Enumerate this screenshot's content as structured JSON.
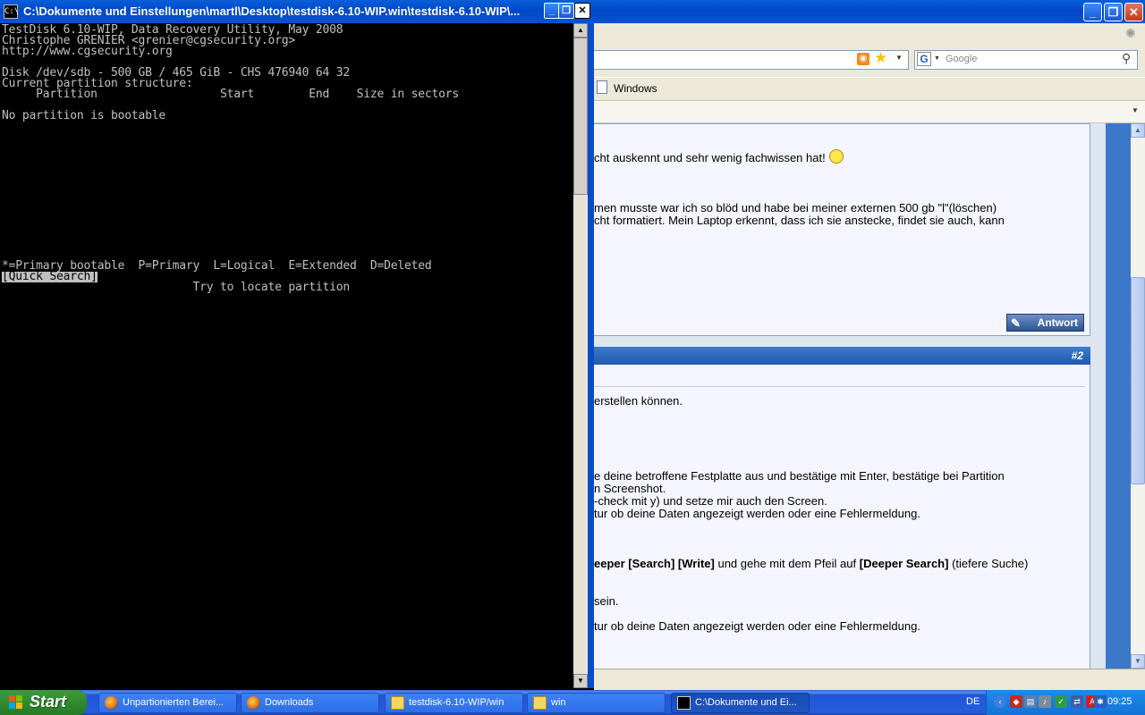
{
  "browser": {
    "search_placeholder": "Google",
    "bookmark_label": "Windows",
    "post1": {
      "line1": "cht auskennt und sehr wenig fachwissen hat!",
      "line2": "men musste war ich so blöd und habe bei meiner externen 500 gb \"l\"(löschen)",
      "line3": "cht formatiert. Mein Laptop erkennt, dass ich sie anstecke, findet sie auch, kann",
      "reply_label": "Antwort"
    },
    "post2": {
      "number": "#2",
      "line1": "erstellen können.",
      "line2": "e deine betroffene Festplatte aus und bestätige mit Enter, bestätige bei Partition",
      "line3": "n Screenshot.",
      "line4": "-check mit y) und setze mir auch den Screen.",
      "line5": "tur ob deine Daten angezeigt werden oder eine Fehlermeldung.",
      "line6_b1": "eeper [Search] [Write]",
      "line6_t1": " und gehe mit dem Pfeil auf ",
      "line6_b2": "[Deeper Search]",
      "line6_t2": " (tiefere Suche)",
      "line7": "sein.",
      "line8": "tur ob deine Daten angezeigt werden oder eine Fehlermeldung."
    }
  },
  "console": {
    "title": "C:\\Dokumente und Einstellungen\\martl\\Desktop\\testdisk-6.10-WIP.win\\testdisk-6.10-WIP\\...",
    "lines": [
      "TestDisk 6.10-WIP, Data Recovery Utility, May 2008",
      "Christophe GRENIER <grenier@cgsecurity.org>",
      "http://www.cgsecurity.org",
      "Disk /dev/sdb - 500 GB / 465 GiB - CHS 476940 64 32",
      "Current partition structure:",
      "     Partition                  Start        End    Size in sectors",
      "No partition is bootable",
      "*=Primary bootable  P=Primary  L=Logical  E=Extended  D=Deleted",
      "[Quick Search]",
      "                            Try to locate partition"
    ]
  },
  "taskbar": {
    "start_label": "Start",
    "items": [
      {
        "label": "Unpartionierten Berei...",
        "icon": "firefox-icon"
      },
      {
        "label": "Downloads",
        "icon": "firefox-icon"
      },
      {
        "label": "testdisk-6.10-WIP/win",
        "icon": "folder-icon"
      },
      {
        "label": "win",
        "icon": "folder-icon"
      },
      {
        "label": "C:\\Dokumente und Ei...",
        "icon": "cmd-icon"
      }
    ],
    "language": "DE",
    "clock": "09:25"
  },
  "colors": {
    "xp_blue": "#0a52d4",
    "start_green": "#2f8b2f",
    "post_header_blue": "#1d5bb0",
    "console_text": "#c0c0c0"
  }
}
